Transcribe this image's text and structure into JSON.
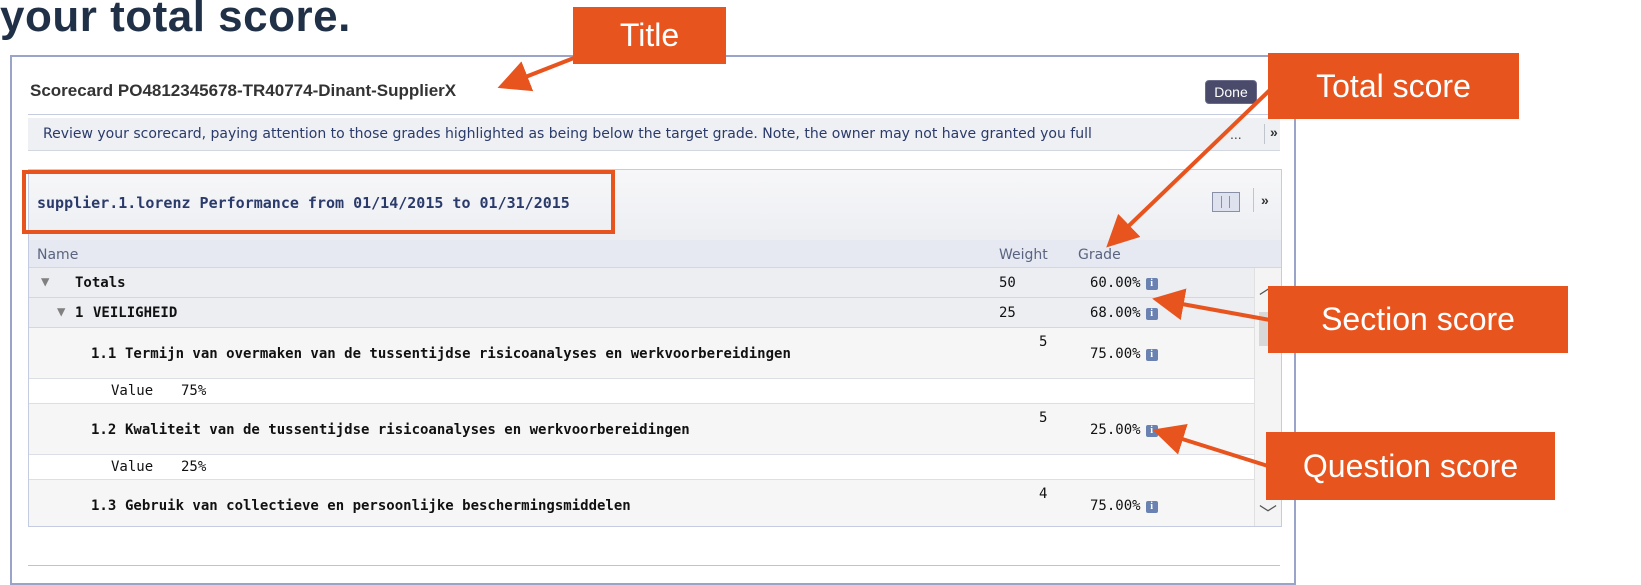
{
  "heading": "your total score.",
  "window": {
    "title": "Scorecard PO4812345678-TR40774-Dinant-SupplierX",
    "done_label": "Done",
    "review_text": "Review your scorecard, paying attention to those grades highlighted as being below the target grade.  Note, the owner may not have granted you full",
    "review_more": "...",
    "review_expand_icon": "double-chevron-down-icon"
  },
  "performance": {
    "title": "supplier.1.lorenz Performance from 01/14/2015 to 01/31/2015",
    "columns": {
      "name": "Name",
      "weight": "Weight",
      "grade": "Grade"
    },
    "totals": {
      "name": "Totals",
      "weight": "50",
      "grade": "60.00%"
    },
    "section": {
      "number": "1",
      "name": "VEILIGHEID",
      "weight": "25",
      "grade": "68.00%"
    },
    "questions": [
      {
        "number": "1.1",
        "name": "Termijn van overmaken van de tussentijdse risicoanalyses en werkvoorbereidingen",
        "weight": "5",
        "grade": "75.00%",
        "value_label": "Value",
        "value": "75%"
      },
      {
        "number": "1.2",
        "name": "Kwaliteit van de tussentijdse risicoanalyses en werkvoorbereidingen",
        "weight": "5",
        "grade": "25.00%",
        "value_label": "Value",
        "value": "25%"
      },
      {
        "number": "1.3",
        "name": "Gebruik van collectieve en persoonlijke beschermingsmiddelen",
        "weight": "4",
        "grade": "75.00%"
      }
    ]
  },
  "callouts": {
    "title": "Title",
    "total_score": "Total score",
    "section_score": "Section score",
    "question_score": "Question score"
  },
  "colors": {
    "callout": "#e8541e",
    "heading": "#1f3047",
    "window_border": "#9aa4c8"
  }
}
